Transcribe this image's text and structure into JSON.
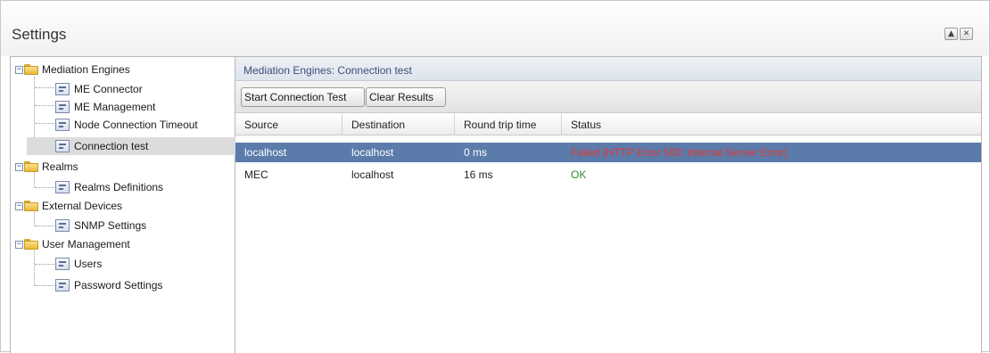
{
  "window": {
    "title": "Settings",
    "collapse_icon": "▲",
    "close_icon": "✕"
  },
  "tree": {
    "expander_symbol": "−",
    "groups": [
      {
        "label": "Mediation Engines",
        "children": [
          "ME Connector",
          "ME Management",
          "Node Connection Timeout",
          "Connection test"
        ]
      },
      {
        "label": "Realms",
        "children": [
          "Realms Definitions"
        ]
      },
      {
        "label": "External Devices",
        "children": [
          "SNMP Settings"
        ]
      },
      {
        "label": "User Management",
        "children": [
          "Users",
          "Password Settings"
        ]
      }
    ],
    "selected_item": "Connection test"
  },
  "panel": {
    "title": "Mediation Engines: Connection test",
    "toolbar": {
      "start_label": "Start Connection Test",
      "clear_label": "Clear Results"
    },
    "columns": [
      "Source",
      "Destination",
      "Round trip time",
      "Status"
    ],
    "rows": [
      {
        "source": "localhost",
        "destination": "localhost",
        "rtt": "0 ms",
        "status": "Failed [HTTP Error 500: Internal Server Error]",
        "selected": true
      },
      {
        "source": "MEC",
        "destination": "localhost",
        "rtt": "16 ms",
        "status": "OK",
        "selected": false
      }
    ]
  },
  "colors": {
    "selection": "#5b7bab",
    "status_failed": "#e23a2e",
    "status_ok": "#2e8b2e"
  }
}
